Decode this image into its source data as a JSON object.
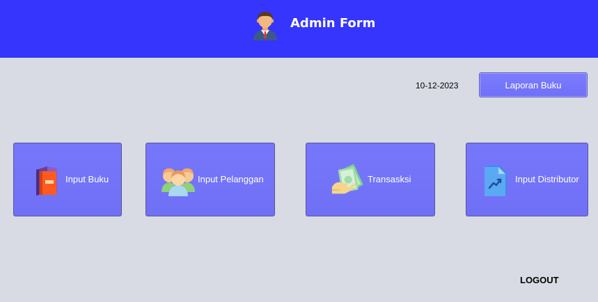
{
  "header": {
    "title": "Admin Form",
    "avatar_icon": "admin-user-icon",
    "background": "#3535fd"
  },
  "toolbar": {
    "date": "10-12-2023",
    "report_button_label": "Laporan Buku"
  },
  "tiles": [
    {
      "label": "Input Buku",
      "icon": "book-icon"
    },
    {
      "label": "Input Pelanggan",
      "icon": "customers-icon"
    },
    {
      "label": "Transasksi",
      "icon": "money-hand-icon"
    },
    {
      "label": "Input Distributor",
      "icon": "chart-document-icon"
    }
  ],
  "footer": {
    "logout_label": "LOGOUT"
  },
  "colors": {
    "tile": "#7474fa",
    "background": "#d8dbe3"
  }
}
